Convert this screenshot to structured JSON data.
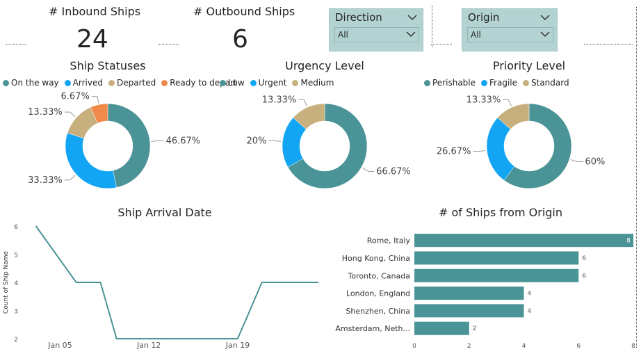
{
  "kpis": [
    {
      "label": "# Inbound Ships",
      "value": "24"
    },
    {
      "label": "# Outbound Ships",
      "value": "6"
    }
  ],
  "slicers": [
    {
      "title": "Direction",
      "selected": "All"
    },
    {
      "title": "Origin",
      "selected": "All"
    }
  ],
  "colors": {
    "teal": "#4a9396",
    "blue": "#12a5f4",
    "tan": "#c8b07e",
    "orange": "#f08a4b",
    "slicer_bg": "#b3d3d3"
  },
  "chart_data": [
    {
      "type": "pie",
      "title": "Ship Statuses",
      "categories": [
        "On the way",
        "Arrived",
        "Departed",
        "Ready to depart"
      ],
      "values": [
        46.67,
        33.33,
        13.33,
        6.67
      ],
      "labels": [
        "46.67%",
        "33.33%",
        "13.33%",
        "6.67%"
      ],
      "colors": [
        "#4a9396",
        "#12a5f4",
        "#c8b07e",
        "#f08a4b"
      ],
      "legend": "top"
    },
    {
      "type": "pie",
      "title": "Urgency Level",
      "categories": [
        "Low",
        "Urgent",
        "Medium"
      ],
      "values": [
        66.67,
        20,
        13.33
      ],
      "labels": [
        "66.67%",
        "20%",
        "13.33%"
      ],
      "colors": [
        "#4a9396",
        "#12a5f4",
        "#c8b07e"
      ],
      "legend": "top"
    },
    {
      "type": "pie",
      "title": "Priority Level",
      "categories": [
        "Perishable",
        "Fragile",
        "Standard"
      ],
      "values": [
        60,
        26.67,
        13.33
      ],
      "labels": [
        "60%",
        "26.67%",
        "13.33%"
      ],
      "colors": [
        "#4a9396",
        "#12a5f4",
        "#c8b07e"
      ],
      "legend": "top"
    },
    {
      "type": "line",
      "title": "Ship Arrival Date",
      "ylabel": "Count of Ship Name",
      "x": [
        1,
        6,
        9,
        11,
        26,
        29,
        36
      ],
      "y": [
        6,
        4,
        4,
        2,
        2,
        4,
        4
      ],
      "xlim": [
        0,
        36
      ],
      "xticks": [
        {
          "v": 4,
          "label": "Jan 05"
        },
        {
          "v": 15,
          "label": "Jan 12"
        },
        {
          "v": 26,
          "label": "Jan 19"
        }
      ],
      "ylim": [
        2,
        6
      ],
      "yticks": [
        "2",
        "3",
        "4",
        "5",
        "6"
      ]
    },
    {
      "type": "bar",
      "orientation": "horizontal",
      "title": "# of Ships from Origin",
      "categories": [
        "Rome, Italy",
        "Hong Kong, China",
        "Toronto, Canada",
        "London, England",
        "Shenzhen, China",
        "Amsterdam, Neth..."
      ],
      "values": [
        8,
        6,
        6,
        4,
        4,
        2
      ],
      "xlim": [
        0,
        8
      ],
      "xticks": [
        "0",
        "2",
        "4",
        "6",
        "8"
      ]
    }
  ]
}
